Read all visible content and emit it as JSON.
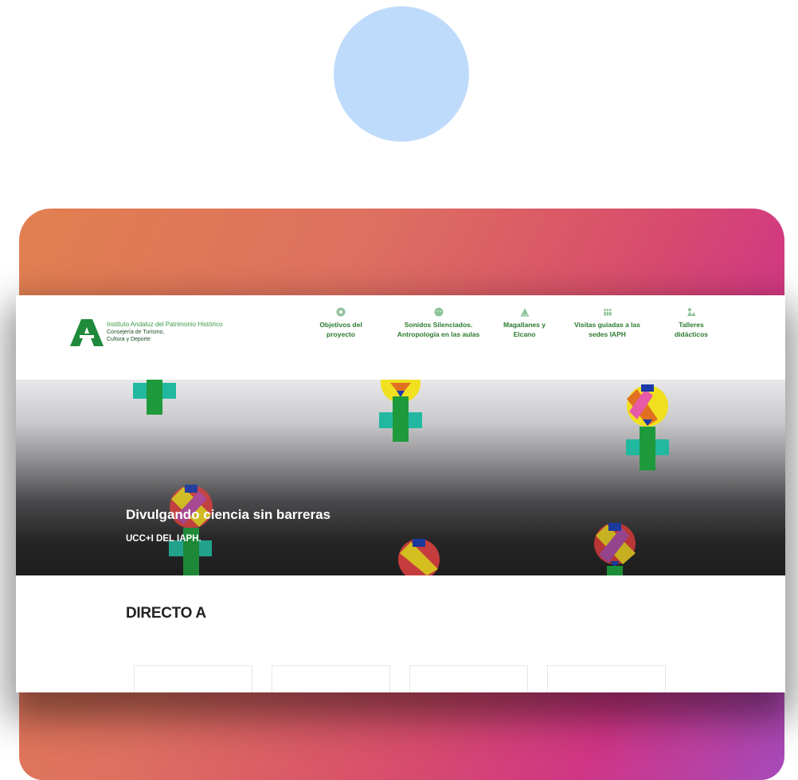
{
  "logo": {
    "line1": "Instituto Andaluz del Patrimonio Histórico",
    "line2": "Consejería de Turismo,",
    "line3": "Cultura y Deporte"
  },
  "nav": {
    "items": [
      {
        "icon": "circle-icon",
        "line1": "Objetivos del",
        "line2": "proyecto"
      },
      {
        "icon": "smiley-icon",
        "line1": "Sonidos Silenciados.",
        "line2": "Antropología en las aulas"
      },
      {
        "icon": "ship-icon",
        "line1": "Magallanes y",
        "line2": "Elcano"
      },
      {
        "icon": "people-icon",
        "line1": "Visitas guiadas a las",
        "line2": "sedes IAPH"
      },
      {
        "icon": "workshop-icon",
        "line1": "Talleres",
        "line2": "didácticos"
      }
    ]
  },
  "hero": {
    "title": "Divulgando ciencia sin barreras",
    "subtitle": "UCC+I DEL IAPH."
  },
  "direct": {
    "heading": "DIRECTO A"
  },
  "colors": {
    "brand_green": "#2a7a2e",
    "avatar_blue": "#bfdbfb",
    "gradient_start": "#e18050",
    "gradient_mid": "#d03585",
    "gradient_end": "#a64aba"
  }
}
